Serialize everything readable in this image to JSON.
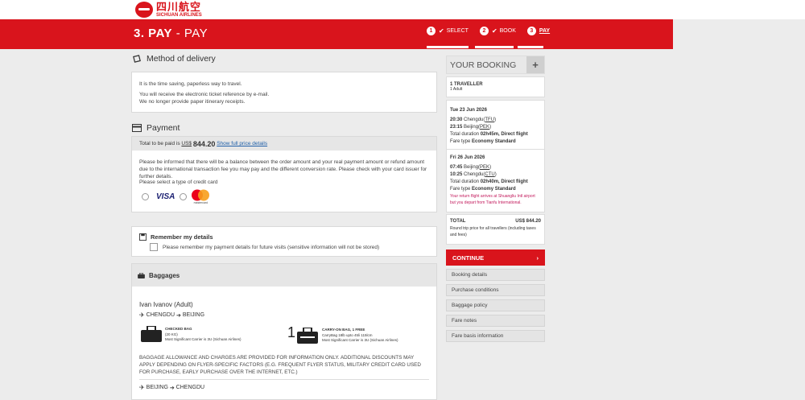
{
  "header": {
    "logo_cn": "四川航空",
    "logo_en": "SICHUAN AIRLINES",
    "step_number": "3. PAY",
    "step_name": "PAY",
    "steps": [
      {
        "num": "1",
        "label": "SELECT"
      },
      {
        "num": "2",
        "label": "BOOK"
      },
      {
        "num": "3",
        "label": "PAY"
      }
    ]
  },
  "delivery": {
    "title": "Method of delivery",
    "line1": "It is the time saving, paperless way to travel.",
    "line2": "You will receive the electronic ticket reference by e-mail.",
    "line3": "We no longer provide paper itinerary receipts."
  },
  "payment": {
    "title": "Payment",
    "total_label": "Total to be paid is",
    "currency": "US$",
    "amount": "844.20",
    "price_link": "Show full price details",
    "notice": "Please be informed that there will be a balance between the order amount and your real payment amount or refund amount due to the international transaction fee you may pay and the different conversion rate. Please check with your card issuer for further details.",
    "select_card": "Please select a type of credit card",
    "cards": {
      "visa": "VISA",
      "mastercard": "mastercard"
    }
  },
  "remember": {
    "title": "Remember my details",
    "checkbox_label": "Please remember my payment details for future visits (sensitive information will not be stored)"
  },
  "baggages": {
    "title": "Baggages",
    "passenger": "Ivan Ivanov (Adult)",
    "route1_from": "CHENGDU",
    "route1_to": "BEIJING",
    "checked_title": "CHECKED BAG",
    "checked_weight": "(20 KG)",
    "checked_carrier": "Most Significant Carrier is 3U (Sichuan Airlines)",
    "carry_count": "1",
    "carry_title": "CARRY-ON BAG, 1 FREE",
    "carry_detail": "CarryBag 18lb upto 45li 115lcm",
    "carry_carrier": "Most Significant Carrier is 3U (Sichuan Airlines)",
    "disclaimer": "BAGGAGE ALLOWANCE AND CHARGES ARE PROVIDED FOR INFORMATION ONLY. ADDITIONAL DISCOUNTS MAY APPLY DEPENDING ON FLYER-SPECIFIC FACTORS (E.G. FREQUENT FLYER STATUS, MILITARY CREDIT CARD USED FOR PURCHASE, EARLY PURCHASE OVER THE INTERNET, ETC.)",
    "route2_from": "BEIJING",
    "route2_to": "CHENGDU"
  },
  "booking": {
    "title": "YOUR BOOKING",
    "expand": "+",
    "traveller": "1 TRAVELLER",
    "adult": "1 Adult",
    "outbound": {
      "date": "Tue 23 Jun 2026",
      "dep_time": "20:30",
      "dep_city": "Chengdu(",
      "dep_code": "TFU",
      "arr_time": "23:15",
      "arr_city": "Beijing(",
      "arr_code": "PEK",
      "duration_label": "Total duration",
      "duration": "02h45m, Direct flight",
      "fare_label": "Fare type",
      "fare": "Economy Standard"
    },
    "inbound": {
      "date": "Fri 26 Jun 2026",
      "dep_time": "07:45",
      "dep_city": "Beijing(",
      "dep_code": "PEK",
      "arr_time": "10:25",
      "arr_city": "Chengdu(",
      "arr_code": "CTU",
      "duration_label": "Total duration",
      "duration": "02h40m, Direct flight",
      "fare_label": "Fare type",
      "fare": "Economy Standard",
      "warning": "Your return flight arrives at Shuangliu Intl airport but you depart from Tianfu International."
    },
    "total_label": "TOTAL",
    "total_value": "US$ 844.20",
    "total_note": "Round trip price for all travellers (including taxes and fees)",
    "continue": "CONTINUE",
    "links": [
      "Booking details",
      "Purchase conditions",
      "Baggage policy",
      "Fare notes",
      "Fare basis information"
    ]
  },
  "colors": {
    "brand_red": "#d9141c",
    "background": "#ececec",
    "warning_text": "#c2185b",
    "link": "#1f5fa8"
  }
}
